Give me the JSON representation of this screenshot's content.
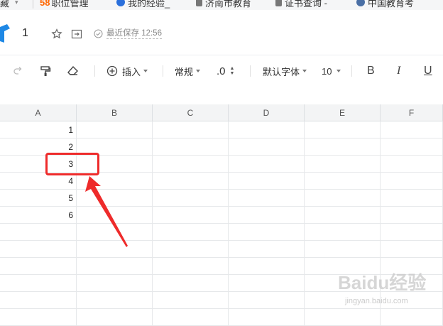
{
  "bookmarks": [
    {
      "label": "藏",
      "icon": "bookmark-icon"
    },
    {
      "label": "职位管理",
      "prefix": "58",
      "icon": "brand-58-icon"
    },
    {
      "label": "我的经验_",
      "icon": "baidu-paw-icon"
    },
    {
      "label": "济南市教育",
      "icon": "page-icon"
    },
    {
      "label": "证书查询 -",
      "icon": "page-icon"
    },
    {
      "label": "中国教育考",
      "icon": "globe-icon"
    }
  ],
  "document": {
    "title": "1",
    "save_status": "最近保存 12:56"
  },
  "toolbar": {
    "insert_label": "插入",
    "format_label": "常规",
    "decimal_label": ".0",
    "font_label": "默认字体",
    "font_size": "10",
    "bold_label": "B",
    "italic_label": "I",
    "underline_label": "U"
  },
  "sheet": {
    "columns": [
      "A",
      "B",
      "C",
      "D",
      "E",
      "F"
    ],
    "column_a_values": [
      "1",
      "2",
      "3",
      "4",
      "5",
      "6"
    ],
    "highlighted_value": "3"
  },
  "watermark": {
    "text": "Baidu经验",
    "sub": "jingyan.baidu.com"
  },
  "colors": {
    "annotation": "#ee2b2b",
    "logo": "#1e88e5",
    "header_bg": "#f3f4f5"
  }
}
